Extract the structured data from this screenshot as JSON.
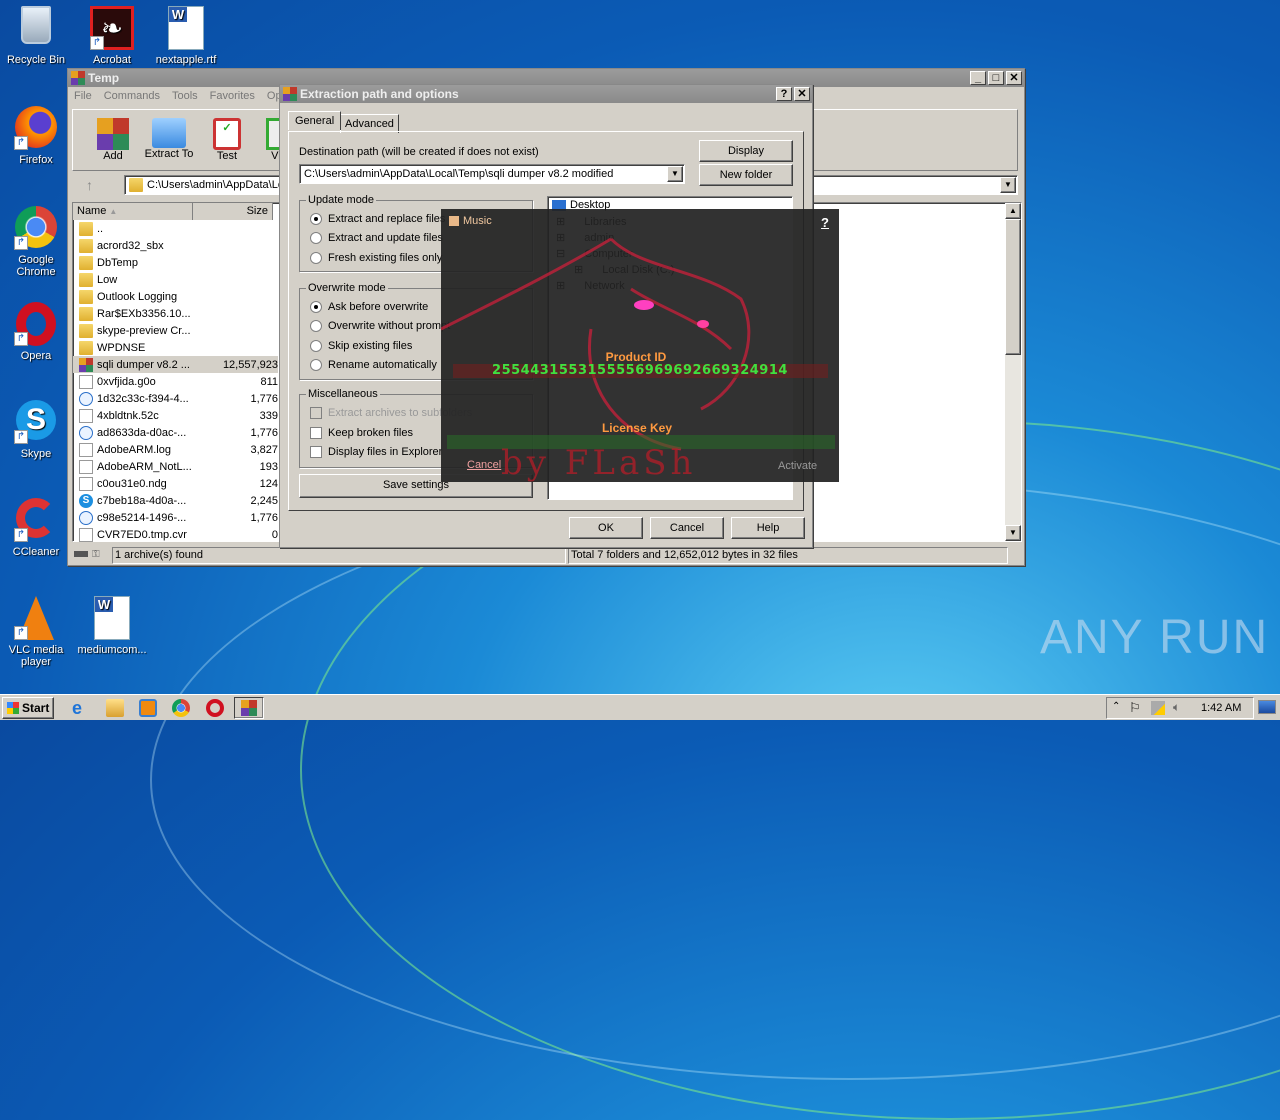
{
  "desktop": {
    "icons": [
      {
        "label": "Recycle Bin",
        "icon": "recycle-bin-icon"
      },
      {
        "label": "Acrobat",
        "icon": "acrobat-icon"
      },
      {
        "label": "nextapple.rtf",
        "icon": "word-document-icon"
      },
      {
        "label": "Firefox",
        "icon": "firefox-icon"
      },
      {
        "label": "Google Chrome",
        "icon": "chrome-icon"
      },
      {
        "label": "Opera",
        "icon": "opera-icon"
      },
      {
        "label": "Skype",
        "icon": "skype-icon"
      },
      {
        "label": "CCleaner",
        "icon": "ccleaner-icon"
      },
      {
        "label": "VLC media player",
        "icon": "vlc-icon"
      },
      {
        "label": "mediumcom...",
        "icon": "word-document-icon"
      }
    ],
    "watermark": "ANY RUN"
  },
  "winrar": {
    "title": "Temp",
    "menu": [
      "File",
      "Commands",
      "Tools",
      "Favorites",
      "Opt"
    ],
    "toolbar": [
      "Add",
      "Extract To",
      "Test",
      "Vie"
    ],
    "address": "C:\\Users\\admin\\AppData\\Lo",
    "columns": {
      "name": "Name",
      "size": "Size"
    },
    "files": [
      {
        "name": "..",
        "size": "",
        "type": "folder"
      },
      {
        "name": "acrord32_sbx",
        "size": "",
        "type": "folder"
      },
      {
        "name": "DbTemp",
        "size": "",
        "type": "folder"
      },
      {
        "name": "Low",
        "size": "",
        "type": "folder"
      },
      {
        "name": "Outlook Logging",
        "size": "",
        "type": "folder"
      },
      {
        "name": "Rar$EXb3356.10...",
        "size": "",
        "type": "folder"
      },
      {
        "name": "skype-preview Cr...",
        "size": "",
        "type": "folder"
      },
      {
        "name": "WPDNSE",
        "size": "",
        "type": "folder"
      },
      {
        "name": "sqli dumper v8.2 ...",
        "size": "12,557,923",
        "type": "rar"
      },
      {
        "name": "0xvfjida.g0o",
        "size": "811",
        "type": "doc"
      },
      {
        "name": "1d32c33c-f394-4...",
        "size": "1,776",
        "type": "crl"
      },
      {
        "name": "4xbldtnk.52c",
        "size": "339",
        "type": "doc"
      },
      {
        "name": "ad8633da-d0ac-...",
        "size": "1,776",
        "type": "crl"
      },
      {
        "name": "AdobeARM.log",
        "size": "3,827",
        "type": "doc"
      },
      {
        "name": "AdobeARM_NotL...",
        "size": "193",
        "type": "doc"
      },
      {
        "name": "c0ou31e0.ndg",
        "size": "124",
        "type": "doc"
      },
      {
        "name": "c7beb18a-4d0a-...",
        "size": "2,245",
        "type": "skype"
      },
      {
        "name": "c98e5214-1496-...",
        "size": "1,776",
        "type": "crl"
      },
      {
        "name": "CVR7ED0.tmp.cvr",
        "size": "0",
        "type": "doc"
      }
    ],
    "status_left": "1 archive(s) found",
    "status_right": "Total 7 folders and 12,652,012 bytes in 32 files"
  },
  "dialog": {
    "title": "Extraction path and options",
    "tabs": [
      "General",
      "Advanced"
    ],
    "dest_label": "Destination path (will be created if does not exist)",
    "dest_value": "C:\\Users\\admin\\AppData\\Local\\Temp\\sqli dumper v8.2 modified",
    "display_btn": "Display",
    "newfolder_btn": "New folder",
    "update_mode": {
      "legend": "Update mode",
      "options": [
        "Extract and replace files",
        "Extract and update files",
        "Fresh existing files only"
      ],
      "selected": 0
    },
    "overwrite_mode": {
      "legend": "Overwrite mode",
      "options": [
        "Ask before overwrite",
        "Overwrite without prompt",
        "Skip existing files",
        "Rename automatically"
      ],
      "selected": 0
    },
    "misc": {
      "legend": "Miscellaneous",
      "options": [
        {
          "label": "Extract archives to subfolders",
          "checked": false,
          "disabled": true
        },
        {
          "label": "Keep broken files",
          "checked": false,
          "disabled": false
        },
        {
          "label": "Display files in Explorer",
          "checked": false,
          "disabled": false
        }
      ]
    },
    "save_btn": "Save settings",
    "tree": [
      "Desktop",
      "Libraries",
      "admin",
      "Computer",
      "Local Disk (C:)",
      "Network"
    ],
    "ok": "OK",
    "cancel": "Cancel",
    "help": "Help"
  },
  "crack": {
    "music_label": "Music",
    "help": "?",
    "product_id_label": "Product ID",
    "product_id": "2554431553155556969692669324914",
    "license_label": "License Key",
    "license_value": "",
    "cancel": "Cancel",
    "activate": "Activate",
    "signature": "by FLaSh"
  },
  "taskbar": {
    "start": "Start",
    "apps": [
      "internet-explorer-icon",
      "explorer-icon",
      "media-player-icon",
      "chrome-icon",
      "opera-icon",
      "winrar-icon"
    ],
    "clock": "1:42 AM"
  }
}
